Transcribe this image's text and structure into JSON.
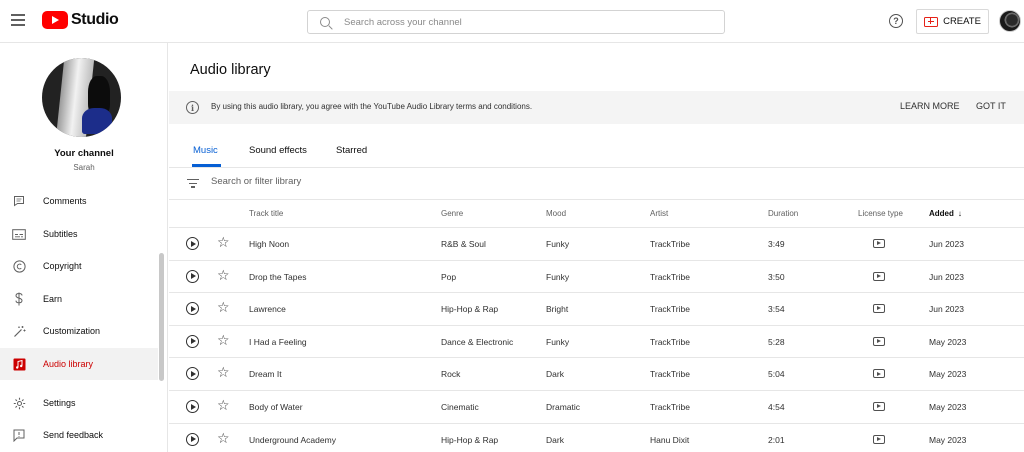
{
  "header": {
    "logo_text": "Studio",
    "search_placeholder": "Search across your channel",
    "help_symbol": "?",
    "create_label": "CREATE"
  },
  "sidebar": {
    "channel_label": "Your channel",
    "channel_name": "Sarah",
    "items": [
      {
        "label": "Comments",
        "icon": "comment-icon"
      },
      {
        "label": "Subtitles",
        "icon": "subtitles-icon"
      },
      {
        "label": "Copyright",
        "icon": "copyright-icon"
      },
      {
        "label": "Earn",
        "icon": "dollar-icon"
      },
      {
        "label": "Customization",
        "icon": "magic-wand-icon"
      },
      {
        "label": "Audio library",
        "icon": "audio-library-icon",
        "active": true
      },
      {
        "label": "Settings",
        "icon": "gear-icon"
      },
      {
        "label": "Send feedback",
        "icon": "feedback-icon"
      }
    ]
  },
  "main": {
    "title": "Audio library",
    "notice": {
      "text": "By using this audio library, you agree with the YouTube Audio Library terms and conditions.",
      "learn_more": "LEARN MORE",
      "got_it": "GOT IT"
    },
    "tabs": [
      {
        "label": "Music",
        "active": true
      },
      {
        "label": "Sound effects"
      },
      {
        "label": "Starred"
      }
    ],
    "filter_placeholder": "Search or filter library",
    "columns": {
      "track_title": "Track title",
      "genre": "Genre",
      "mood": "Mood",
      "artist": "Artist",
      "duration": "Duration",
      "license_type": "License type",
      "added": "Added",
      "added_sort": "↓"
    },
    "rows": [
      {
        "title": "High Noon",
        "genre": "R&B & Soul",
        "mood": "Funky",
        "artist": "TrackTribe",
        "duration": "3:49",
        "added": "Jun 2023"
      },
      {
        "title": "Drop the Tapes",
        "genre": "Pop",
        "mood": "Funky",
        "artist": "TrackTribe",
        "duration": "3:50",
        "added": "Jun 2023"
      },
      {
        "title": "Lawrence",
        "genre": "Hip-Hop & Rap",
        "mood": "Bright",
        "artist": "TrackTribe",
        "duration": "3:54",
        "added": "Jun 2023"
      },
      {
        "title": "I Had a Feeling",
        "genre": "Dance & Electronic",
        "mood": "Funky",
        "artist": "TrackTribe",
        "duration": "5:28",
        "added": "May 2023"
      },
      {
        "title": "Dream It",
        "genre": "Rock",
        "mood": "Dark",
        "artist": "TrackTribe",
        "duration": "5:04",
        "added": "May 2023"
      },
      {
        "title": "Body of Water",
        "genre": "Cinematic",
        "mood": "Dramatic",
        "artist": "TrackTribe",
        "duration": "4:54",
        "added": "May 2023"
      },
      {
        "title": "Underground Academy",
        "genre": "Hip-Hop & Rap",
        "mood": "Dark",
        "artist": "Hanu Dixit",
        "duration": "2:01",
        "added": "May 2023"
      }
    ]
  },
  "colors": {
    "brand_red": "#ff0000",
    "active_red": "#cc0000",
    "tab_blue": "#065fd4"
  }
}
